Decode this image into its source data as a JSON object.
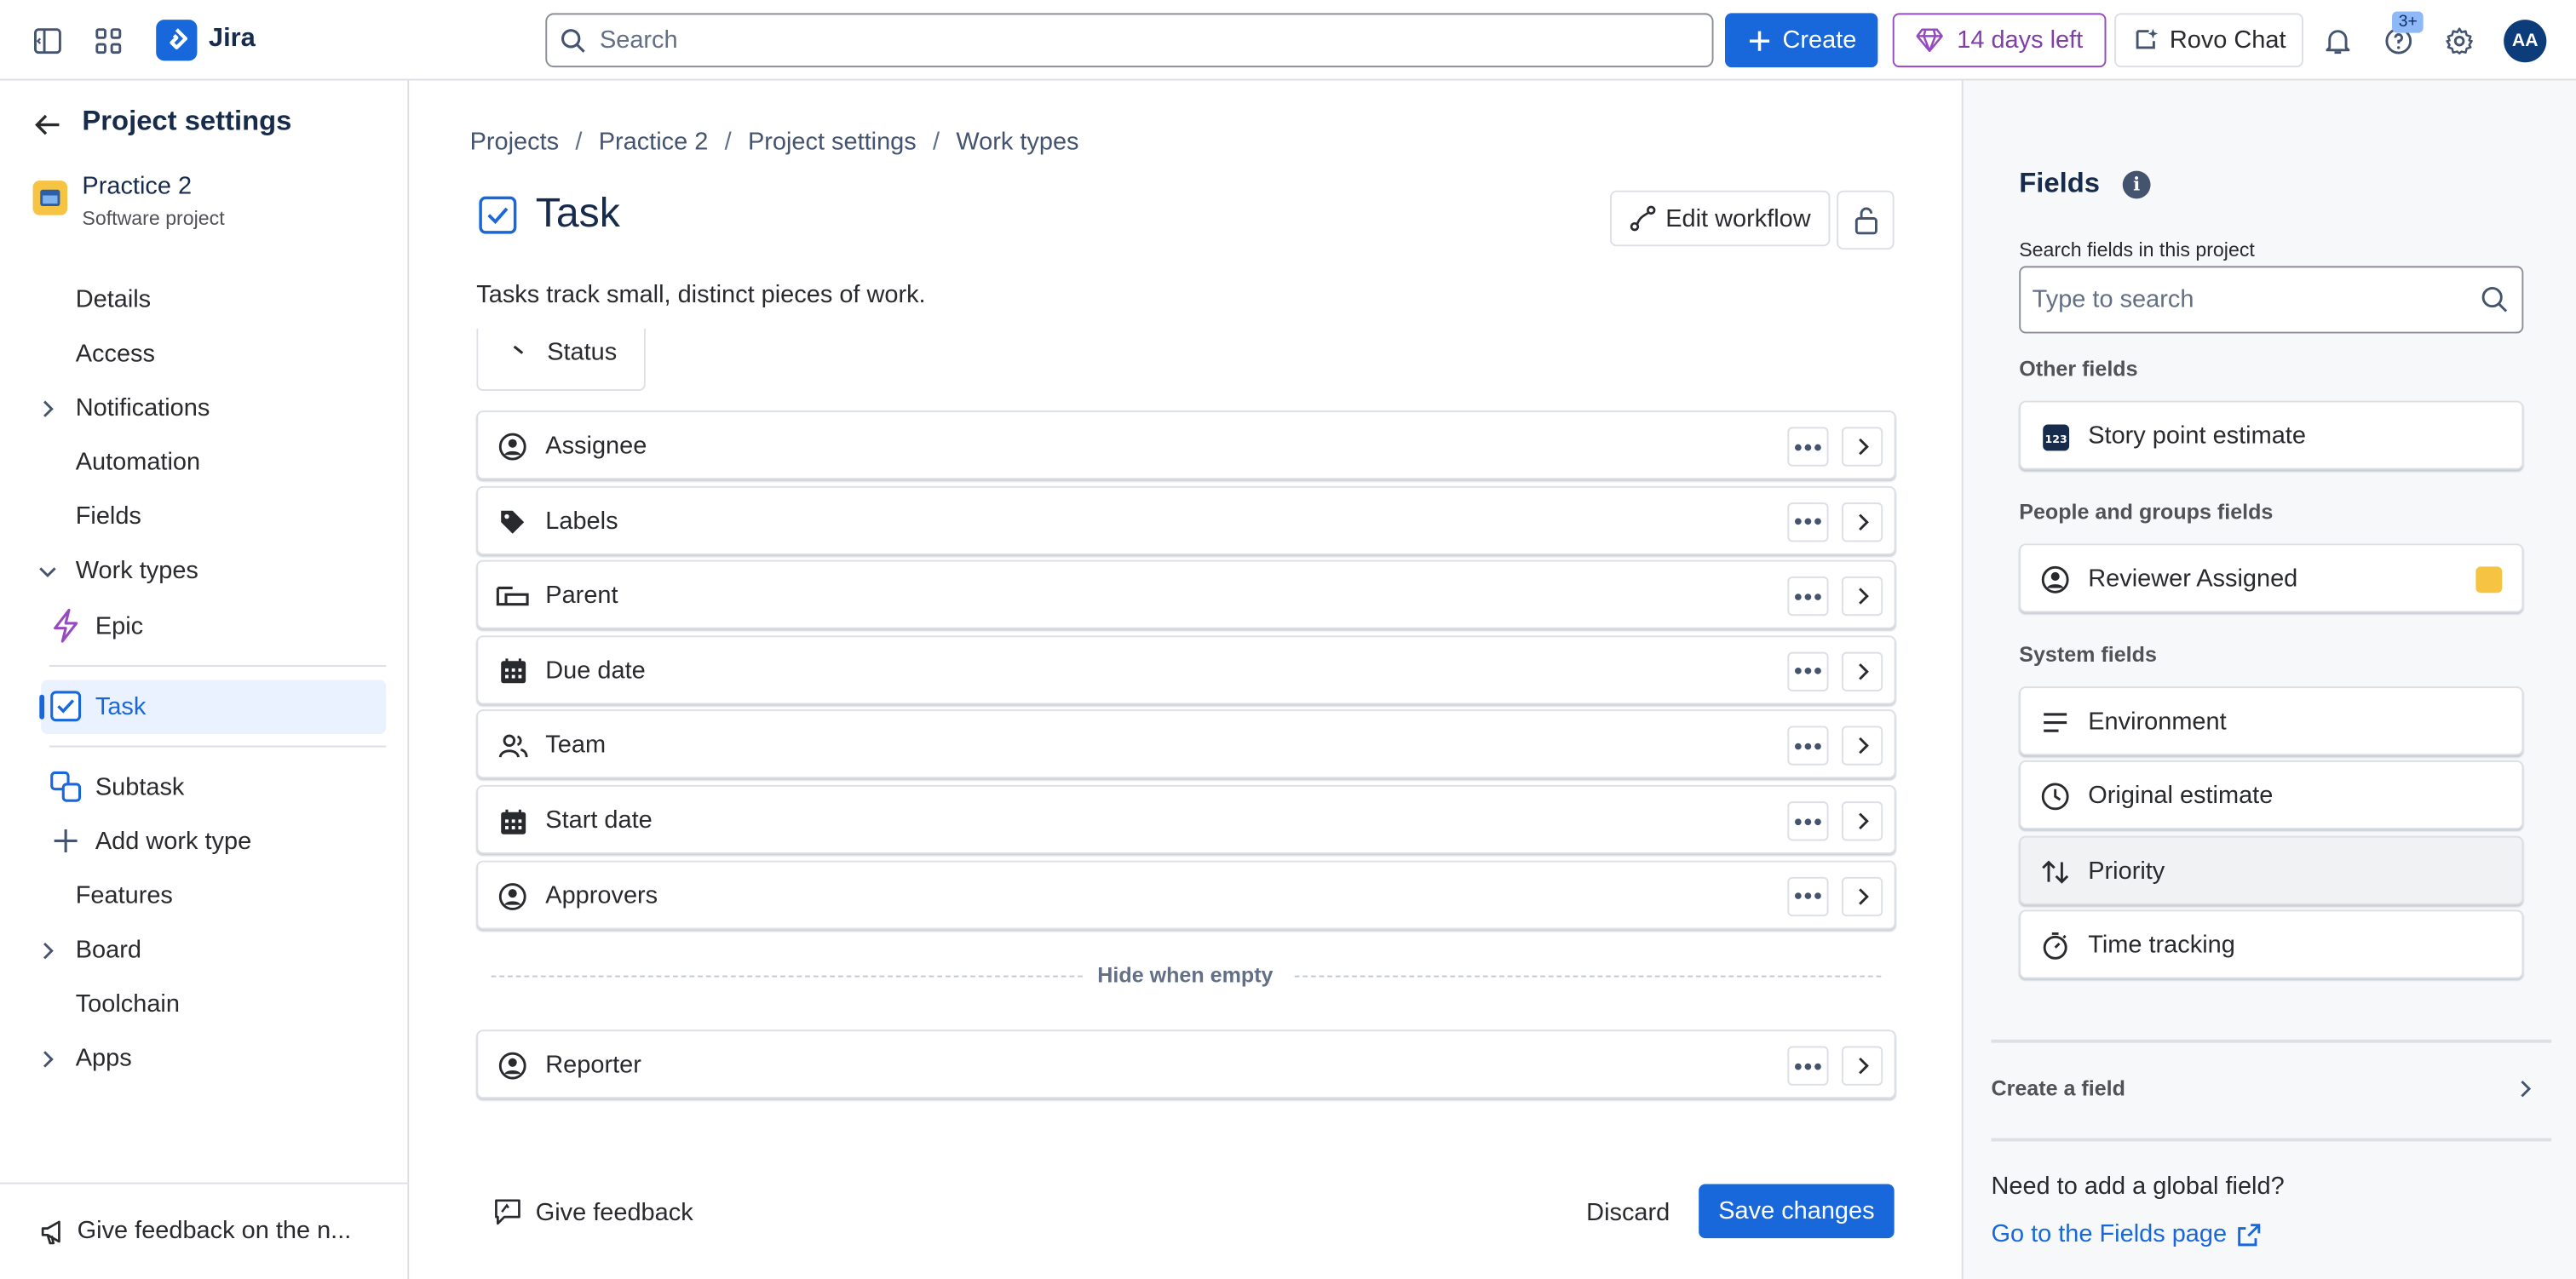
{
  "topbar": {
    "app_name": "Jira",
    "search_placeholder": "Search",
    "create_label": "Create",
    "trial_label": "14 days left",
    "rovo_label": "Rovo Chat",
    "help_badge": "3+",
    "avatar_initials": "AA",
    "icons": [
      "sidebar-toggle-icon",
      "app-switcher-icon",
      "jira-logo-icon",
      "search-icon",
      "plus-icon",
      "gem-icon",
      "rovo-icon",
      "bell-icon",
      "help-icon",
      "gear-icon"
    ]
  },
  "sidebar": {
    "title": "Project settings",
    "project_name": "Practice 2",
    "project_type": "Software project",
    "items": {
      "details": "Details",
      "access": "Access",
      "notifications": "Notifications",
      "automation": "Automation",
      "fields": "Fields",
      "work_types": "Work types",
      "epic": "Epic",
      "task": "Task",
      "subtask": "Subtask",
      "add_work_type": "Add work type",
      "features": "Features",
      "board": "Board",
      "toolchain": "Toolchain",
      "apps": "Apps"
    },
    "footer": "Give feedback on the n..."
  },
  "main": {
    "breadcrumbs": [
      "Projects",
      "Practice 2",
      "Project settings",
      "Work types"
    ],
    "title": "Task",
    "description": "Tasks track small, distinct pieces of work.",
    "edit_workflow": "Edit workflow",
    "status_stub": "Status",
    "fields": [
      {
        "label": "Assignee",
        "icon": "person-icon"
      },
      {
        "label": "Labels",
        "icon": "tag-icon"
      },
      {
        "label": "Parent",
        "icon": "parent-icon"
      },
      {
        "label": "Due date",
        "icon": "calendar-icon"
      },
      {
        "label": "Team",
        "icon": "team-icon"
      },
      {
        "label": "Start date",
        "icon": "calendar-icon"
      },
      {
        "label": "Approvers",
        "icon": "person-icon"
      }
    ],
    "hide_when_empty": "Hide when empty",
    "hidden_fields": [
      {
        "label": "Reporter",
        "icon": "person-icon"
      }
    ],
    "give_feedback": "Give feedback",
    "discard": "Discard",
    "save": "Save changes"
  },
  "panel": {
    "title": "Fields",
    "search_label": "Search fields in this project",
    "search_placeholder": "Type to search",
    "groups": {
      "other": "Other fields",
      "people": "People and groups fields",
      "system": "System fields"
    },
    "other_fields": [
      "Story point estimate"
    ],
    "people_fields": [
      "Reviewer Assigned"
    ],
    "system_fields": [
      "Environment",
      "Original estimate",
      "Priority",
      "Time tracking"
    ],
    "create_field": "Create a field",
    "need_global": "Need to add a global field?",
    "fields_page_link": "Go to the Fields page"
  },
  "colors": {
    "brand_blue": "#1868db",
    "trial_purple": "#803fa5",
    "selected_bg": "#e9f2fe",
    "panel_bg": "#f7f8f9"
  }
}
